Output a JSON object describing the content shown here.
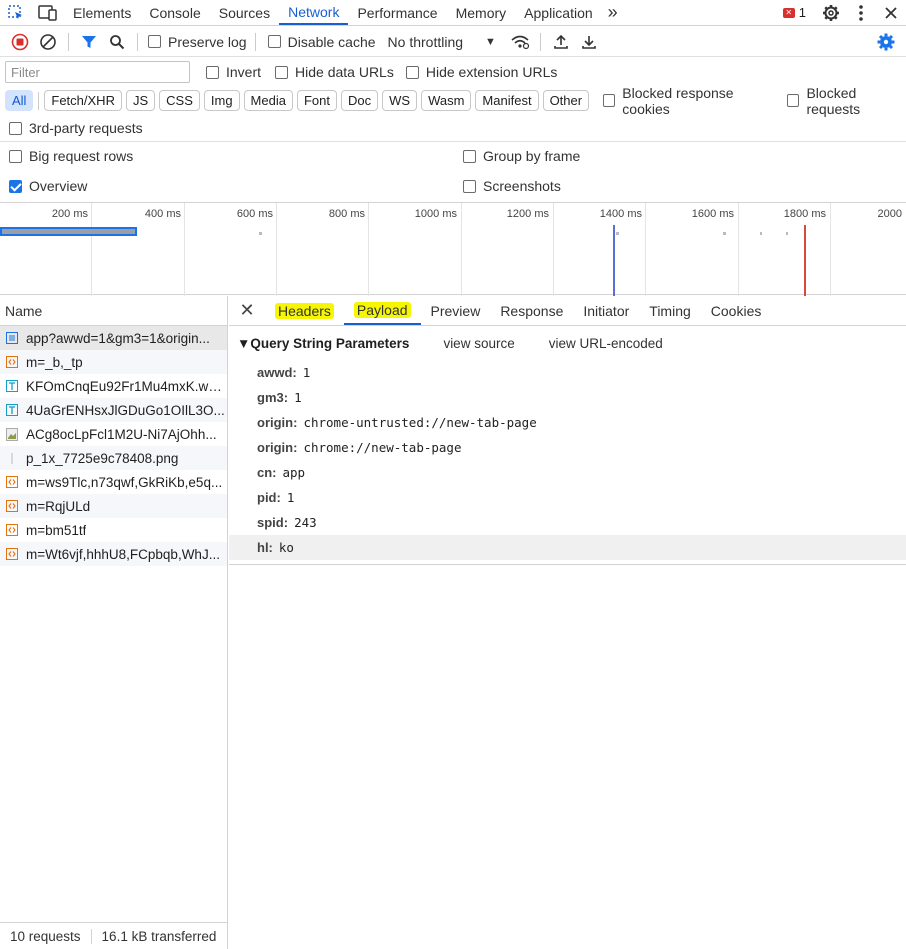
{
  "topbar": {
    "tabs": [
      "Elements",
      "Console",
      "Sources",
      "Network",
      "Performance",
      "Memory",
      "Application"
    ],
    "active_tab": "Network",
    "more": "»",
    "error_count": "1"
  },
  "toolbar": {
    "preserve_log": "Preserve log",
    "disable_cache": "Disable cache",
    "throttling": "No throttling"
  },
  "filter": {
    "placeholder": "Filter",
    "invert": "Invert",
    "hide_data_urls": "Hide data URLs",
    "hide_extension_urls": "Hide extension URLs"
  },
  "types": [
    "All",
    "Fetch/XHR",
    "JS",
    "CSS",
    "Img",
    "Media",
    "Font",
    "Doc",
    "WS",
    "Wasm",
    "Manifest",
    "Other"
  ],
  "type_options": {
    "blocked_response_cookies": "Blocked response cookies",
    "blocked_requests": "Blocked requests",
    "third_party": "3rd-party requests"
  },
  "settings": {
    "big_request_rows": "Big request rows",
    "group_by_frame": "Group by frame",
    "overview": "Overview",
    "screenshots": "Screenshots"
  },
  "overview_ticks": [
    "200 ms",
    "400 ms",
    "600 ms",
    "800 ms",
    "1000 ms",
    "1200 ms",
    "1400 ms",
    "1600 ms",
    "1800 ms",
    "2000"
  ],
  "requests": {
    "header": "Name",
    "items": [
      {
        "name": "app?awwd=1&gm3=1&origin...",
        "type": "doc",
        "color": "#1a73e8"
      },
      {
        "name": "m=_b,_tp",
        "type": "script",
        "color": "#e8710a"
      },
      {
        "name": "KFOmCnqEu92Fr1Mu4mxK.wo...",
        "type": "font",
        "color": "#12a0c8"
      },
      {
        "name": "4UaGrENHsxJlGDuGo1OIlL3O...",
        "type": "font",
        "color": "#12a0c8"
      },
      {
        "name": "ACg8ocLpFcl1M2U-Ni7AjOhh...",
        "type": "img",
        "color": "#8d9a4a"
      },
      {
        "name": "p_1x_7725e9c78408.png",
        "type": "png",
        "color": "#bbbbbb"
      },
      {
        "name": "m=ws9Tlc,n73qwf,GkRiKb,e5q...",
        "type": "script",
        "color": "#e8710a"
      },
      {
        "name": "m=RqjULd",
        "type": "script",
        "color": "#e8710a"
      },
      {
        "name": "m=bm51tf",
        "type": "script",
        "color": "#e8710a"
      },
      {
        "name": "m=Wt6vjf,hhhU8,FCpbqb,WhJ...",
        "type": "script",
        "color": "#e8710a"
      }
    ],
    "count": "10 requests",
    "transferred": "16.1 kB transferred"
  },
  "detail_tabs": [
    "Headers",
    "Payload",
    "Preview",
    "Response",
    "Initiator",
    "Timing",
    "Cookies"
  ],
  "active_detail_tab": "Payload",
  "payload": {
    "section_title": "▼Query String Parameters",
    "view_source": "view source",
    "view_url_encoded": "view URL-encoded",
    "params": [
      {
        "key": "awwd:",
        "value": "1"
      },
      {
        "key": "gm3:",
        "value": "1"
      },
      {
        "key": "origin:",
        "value": "chrome-untrusted://new-tab-page"
      },
      {
        "key": "origin:",
        "value": "chrome://new-tab-page"
      },
      {
        "key": "cn:",
        "value": "app"
      },
      {
        "key": "pid:",
        "value": "1"
      },
      {
        "key": "spid:",
        "value": "243"
      },
      {
        "key": "hl:",
        "value": "ko"
      }
    ]
  },
  "colors": {
    "accent": "#1a5fd0",
    "highlight": "#f6f600",
    "error": "#d9302d"
  }
}
